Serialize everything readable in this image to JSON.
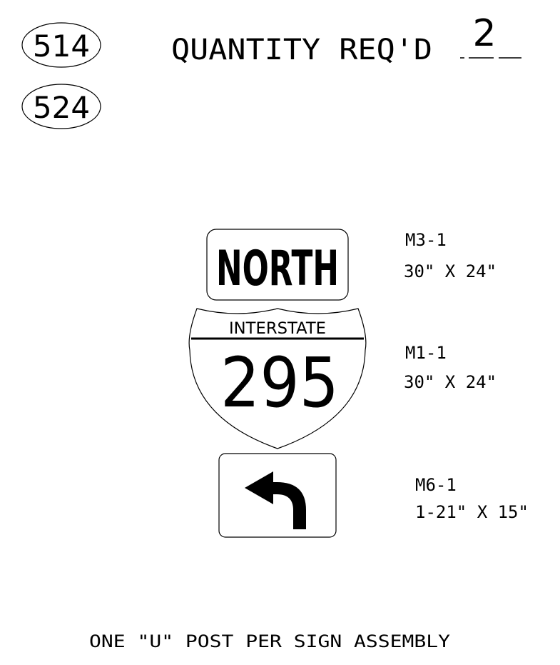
{
  "header": {
    "sheet_ids": [
      "514",
      "524"
    ],
    "quantity_label": "QUANTITY REQ'D",
    "quantity_value": "2"
  },
  "signs": [
    {
      "id": "north-sign",
      "legend": "NORTH",
      "code": "M3-1",
      "size": "30\" X 24\""
    },
    {
      "id": "interstate-shield",
      "top_legend": "INTERSTATE",
      "route": "295",
      "code": "M1-1",
      "size": "30\" X 24\""
    },
    {
      "id": "arrow-sign",
      "icon": "left-turn-arrow-icon",
      "code": "M6-1",
      "size": "1-21\" X 15\""
    }
  ],
  "footer": {
    "note": "ONE \"U\" POST PER SIGN ASSEMBLY"
  }
}
